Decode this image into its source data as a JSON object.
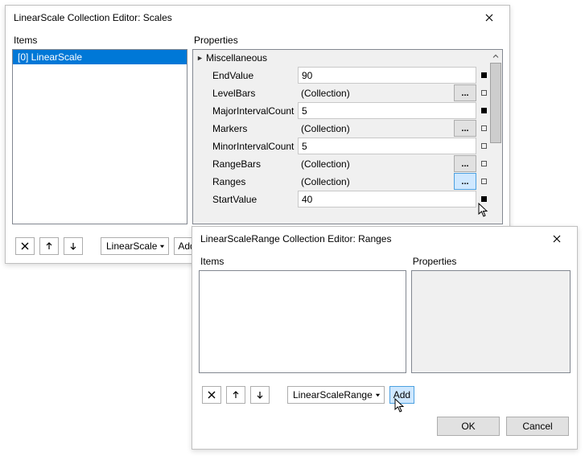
{
  "dialog1": {
    "title": "LinearScale Collection Editor: Scales",
    "items_label": "Items",
    "properties_label": "Properties",
    "list": [
      {
        "text": "[0] LinearScale",
        "selected": true
      }
    ],
    "category": "Miscellaneous",
    "props": [
      {
        "name": "EndValue",
        "value": "90",
        "input": true,
        "ellipsis": false,
        "filled": true
      },
      {
        "name": "LevelBars",
        "value": "(Collection)",
        "input": false,
        "ellipsis": true,
        "filled": false
      },
      {
        "name": "MajorIntervalCount",
        "value": "5",
        "input": true,
        "ellipsis": false,
        "filled": true
      },
      {
        "name": "Markers",
        "value": "(Collection)",
        "input": false,
        "ellipsis": true,
        "filled": false
      },
      {
        "name": "MinorIntervalCount",
        "value": "5",
        "input": true,
        "ellipsis": false,
        "filled": false
      },
      {
        "name": "RangeBars",
        "value": "(Collection)",
        "input": false,
        "ellipsis": true,
        "filled": false
      },
      {
        "name": "Ranges",
        "value": "(Collection)",
        "input": false,
        "ellipsis": true,
        "ellipsis_hl": true,
        "filled": false
      },
      {
        "name": "StartValue",
        "value": "40",
        "input": true,
        "ellipsis": false,
        "filled": true
      }
    ],
    "dropdown_label": "LinearScale",
    "add_label": "Add"
  },
  "dialog2": {
    "title": "LinearScaleRange Collection Editor: Ranges",
    "items_label": "Items",
    "properties_label": "Properties",
    "dropdown_label": "LinearScaleRange",
    "add_label": "Add",
    "ok_label": "OK",
    "cancel_label": "Cancel"
  }
}
